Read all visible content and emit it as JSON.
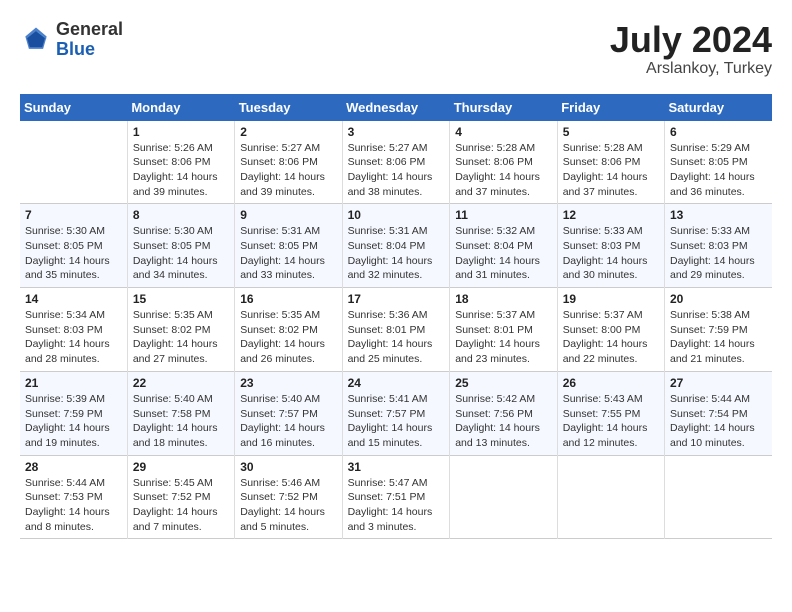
{
  "logo": {
    "general": "General",
    "blue": "Blue"
  },
  "title": {
    "month_year": "July 2024",
    "location": "Arslankoy, Turkey"
  },
  "headers": [
    "Sunday",
    "Monday",
    "Tuesday",
    "Wednesday",
    "Thursday",
    "Friday",
    "Saturday"
  ],
  "weeks": [
    [
      {
        "day": "",
        "info": ""
      },
      {
        "day": "1",
        "info": "Sunrise: 5:26 AM\nSunset: 8:06 PM\nDaylight: 14 hours\nand 39 minutes."
      },
      {
        "day": "2",
        "info": "Sunrise: 5:27 AM\nSunset: 8:06 PM\nDaylight: 14 hours\nand 39 minutes."
      },
      {
        "day": "3",
        "info": "Sunrise: 5:27 AM\nSunset: 8:06 PM\nDaylight: 14 hours\nand 38 minutes."
      },
      {
        "day": "4",
        "info": "Sunrise: 5:28 AM\nSunset: 8:06 PM\nDaylight: 14 hours\nand 37 minutes."
      },
      {
        "day": "5",
        "info": "Sunrise: 5:28 AM\nSunset: 8:06 PM\nDaylight: 14 hours\nand 37 minutes."
      },
      {
        "day": "6",
        "info": "Sunrise: 5:29 AM\nSunset: 8:05 PM\nDaylight: 14 hours\nand 36 minutes."
      }
    ],
    [
      {
        "day": "7",
        "info": "Sunrise: 5:30 AM\nSunset: 8:05 PM\nDaylight: 14 hours\nand 35 minutes."
      },
      {
        "day": "8",
        "info": "Sunrise: 5:30 AM\nSunset: 8:05 PM\nDaylight: 14 hours\nand 34 minutes."
      },
      {
        "day": "9",
        "info": "Sunrise: 5:31 AM\nSunset: 8:05 PM\nDaylight: 14 hours\nand 33 minutes."
      },
      {
        "day": "10",
        "info": "Sunrise: 5:31 AM\nSunset: 8:04 PM\nDaylight: 14 hours\nand 32 minutes."
      },
      {
        "day": "11",
        "info": "Sunrise: 5:32 AM\nSunset: 8:04 PM\nDaylight: 14 hours\nand 31 minutes."
      },
      {
        "day": "12",
        "info": "Sunrise: 5:33 AM\nSunset: 8:03 PM\nDaylight: 14 hours\nand 30 minutes."
      },
      {
        "day": "13",
        "info": "Sunrise: 5:33 AM\nSunset: 8:03 PM\nDaylight: 14 hours\nand 29 minutes."
      }
    ],
    [
      {
        "day": "14",
        "info": "Sunrise: 5:34 AM\nSunset: 8:03 PM\nDaylight: 14 hours\nand 28 minutes."
      },
      {
        "day": "15",
        "info": "Sunrise: 5:35 AM\nSunset: 8:02 PM\nDaylight: 14 hours\nand 27 minutes."
      },
      {
        "day": "16",
        "info": "Sunrise: 5:35 AM\nSunset: 8:02 PM\nDaylight: 14 hours\nand 26 minutes."
      },
      {
        "day": "17",
        "info": "Sunrise: 5:36 AM\nSunset: 8:01 PM\nDaylight: 14 hours\nand 25 minutes."
      },
      {
        "day": "18",
        "info": "Sunrise: 5:37 AM\nSunset: 8:01 PM\nDaylight: 14 hours\nand 23 minutes."
      },
      {
        "day": "19",
        "info": "Sunrise: 5:37 AM\nSunset: 8:00 PM\nDaylight: 14 hours\nand 22 minutes."
      },
      {
        "day": "20",
        "info": "Sunrise: 5:38 AM\nSunset: 7:59 PM\nDaylight: 14 hours\nand 21 minutes."
      }
    ],
    [
      {
        "day": "21",
        "info": "Sunrise: 5:39 AM\nSunset: 7:59 PM\nDaylight: 14 hours\nand 19 minutes."
      },
      {
        "day": "22",
        "info": "Sunrise: 5:40 AM\nSunset: 7:58 PM\nDaylight: 14 hours\nand 18 minutes."
      },
      {
        "day": "23",
        "info": "Sunrise: 5:40 AM\nSunset: 7:57 PM\nDaylight: 14 hours\nand 16 minutes."
      },
      {
        "day": "24",
        "info": "Sunrise: 5:41 AM\nSunset: 7:57 PM\nDaylight: 14 hours\nand 15 minutes."
      },
      {
        "day": "25",
        "info": "Sunrise: 5:42 AM\nSunset: 7:56 PM\nDaylight: 14 hours\nand 13 minutes."
      },
      {
        "day": "26",
        "info": "Sunrise: 5:43 AM\nSunset: 7:55 PM\nDaylight: 14 hours\nand 12 minutes."
      },
      {
        "day": "27",
        "info": "Sunrise: 5:44 AM\nSunset: 7:54 PM\nDaylight: 14 hours\nand 10 minutes."
      }
    ],
    [
      {
        "day": "28",
        "info": "Sunrise: 5:44 AM\nSunset: 7:53 PM\nDaylight: 14 hours\nand 8 minutes."
      },
      {
        "day": "29",
        "info": "Sunrise: 5:45 AM\nSunset: 7:52 PM\nDaylight: 14 hours\nand 7 minutes."
      },
      {
        "day": "30",
        "info": "Sunrise: 5:46 AM\nSunset: 7:52 PM\nDaylight: 14 hours\nand 5 minutes."
      },
      {
        "day": "31",
        "info": "Sunrise: 5:47 AM\nSunset: 7:51 PM\nDaylight: 14 hours\nand 3 minutes."
      },
      {
        "day": "",
        "info": ""
      },
      {
        "day": "",
        "info": ""
      },
      {
        "day": "",
        "info": ""
      }
    ]
  ]
}
